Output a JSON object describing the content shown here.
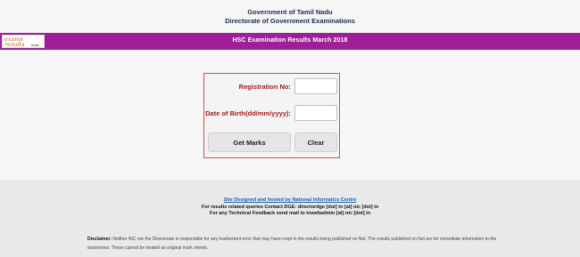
{
  "header": {
    "org": "Government of Tamil Nadu",
    "directorate": "Directorate of Government Examinations"
  },
  "banner": {
    "title": "HSC  Examination Results  March 2018",
    "logo_line1": "exams",
    "logo_line2": "results",
    "logo_line3": "India",
    "color": "#a01f98"
  },
  "form": {
    "registration_label": "Registration No:",
    "registration_value": "",
    "dob_label": "Date of Birth(dd/mm/yyyy):",
    "dob_value": "",
    "get_marks": "Get Marks",
    "clear": "Clear"
  },
  "footer": {
    "site_link": "Site Designed and hosted by National Informatics Centre",
    "line1": "For results related queries Contact DGE:  directordge [dot] tn [at] nic [dot] in",
    "line2": "For any Technical Feedback send mail to tnwebadmin [at] nic [dot] in",
    "disclaimer_label": "Disclaimer:",
    "disclaimer_text": " Neither NIC nor the Directorate is responsible for any inadvertent error that may have crept in the results being published on Net. The results published on Net are for immediate information to the examinees. These cannot be treated as original mark sheets."
  }
}
